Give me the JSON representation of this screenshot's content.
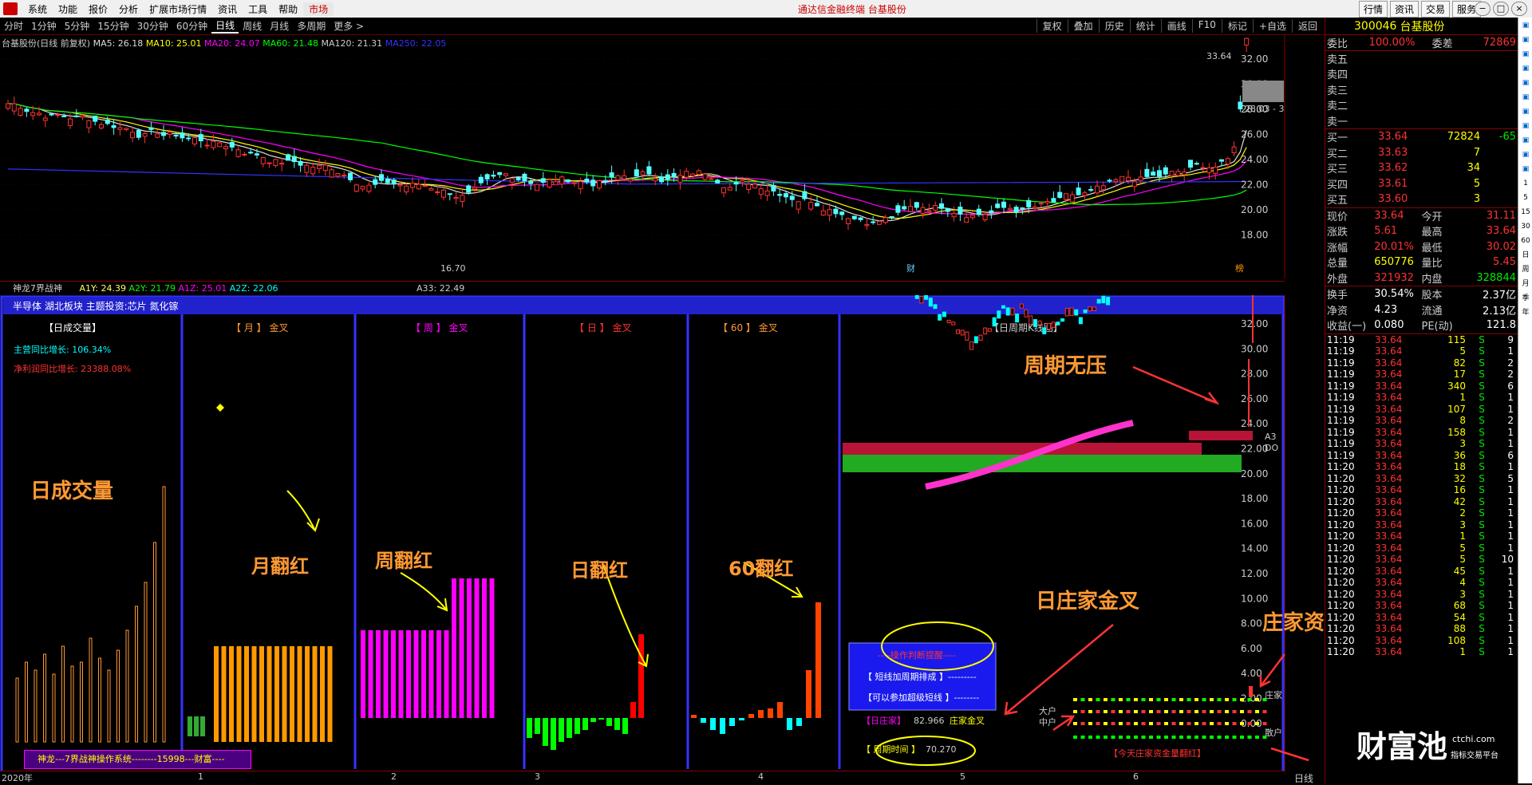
{
  "menu": [
    "系统",
    "功能",
    "报价",
    "分析",
    "扩展市场行情",
    "资讯",
    "工具",
    "帮助",
    "市场"
  ],
  "app_title": "通达信金融终端 台基股份",
  "top_buttons": [
    "行情",
    "资讯",
    "交易",
    "服务"
  ],
  "periods": [
    "分时",
    "1分钟",
    "5分钟",
    "15分钟",
    "30分钟",
    "60分钟",
    "日线",
    "周线",
    "月线",
    "多周期",
    "更多 >"
  ],
  "active_period": "日线",
  "toolbar": [
    "复权",
    "叠加",
    "历史",
    "统计",
    "画线",
    "F10",
    "标记",
    "+自选",
    "返回"
  ],
  "main_legend": {
    "name": "台基股份(日线 前复权)",
    "ma5": "MA5: 26.18",
    "ma10": "MA10: 25.01",
    "ma20": "MA20: 24.07",
    "ma60": "MA60: 21.48",
    "ma120": "MA120: 21.31",
    "ma250": "MA250: 22.05"
  },
  "main_axis": [
    "32.00",
    "30.00",
    "28.00",
    "26.00",
    "24.00",
    "22.00",
    "20.00",
    "18.00"
  ],
  "main_labels": {
    "high": "33.64",
    "low": "16.70",
    "box": "28.03 - 3",
    "cai": "财",
    "gift": "榜"
  },
  "sub_legend": {
    "name": "神龙7界战神",
    "a1y": "A1Y: 24.39",
    "a2y": "A2Y: 21.79",
    "a1z": "A1Z: 25.01",
    "a2z": "A2Z: 22.06",
    "a33": "A33: 22.49"
  },
  "info_bar": "半导体 湖北板块 主题投资:芯片 氮化镓",
  "panels": {
    "p1_title": "【日成交量】",
    "p1_l1": "主营同比增长: 106.34%",
    "p1_l2": "净利润同比增长: 23388.08%",
    "p2_title": "【 月 】  金叉",
    "p3_title": "【 周 】  金叉",
    "p4_title": "【 日 】  金叉",
    "p5_title": "【 60 】  金叉",
    "p6_title": "【日周期K线图】"
  },
  "sub_axis": [
    "32.00",
    "30.00",
    "28.00",
    "26.00",
    "24.00",
    "22.00",
    "20.00",
    "18.00",
    "16.00",
    "14.00",
    "12.00",
    "10.00",
    "8.00",
    "6.00",
    "4.00",
    "2.00",
    "0.00"
  ],
  "side_labels": {
    "a3": "A3",
    "do": "DO",
    "zhuang": "庄家",
    "sanhu": "散户",
    "dahu": "大户",
    "zhonghu": "中户"
  },
  "ops": {
    "title": "----操作判断提醒----",
    "l1": "【 短线加周期排成 】---------",
    "l2": "【可以参加超级短线 】--------",
    "zj": "【日庄家】",
    "zj_val": "82.966",
    "zj_tag": "庄家金叉",
    "time": "【 周期时间 】",
    "time_val": "70.270",
    "today": "【今天庄家资金量翻红】"
  },
  "annotations": {
    "a1": "日成交量",
    "a2": "月翻红",
    "a3": "周翻红",
    "a4": "日翻红",
    "a5": "60翻红",
    "a6": "周期无压",
    "a7": "日庄家金叉",
    "a8": "庄家资金能量翻红"
  },
  "footer_label": "神龙---7界战神操作系统--------15998---财富----",
  "x_axis": [
    "2020年",
    "1",
    "2",
    "3",
    "4",
    "5",
    "6"
  ],
  "x_axis_right": "日线",
  "quote": {
    "code": "300046",
    "name": "台基股份",
    "wb_label": "委比",
    "wb_val": "100.00%",
    "wc_label": "委差",
    "wc_val": "72869",
    "sells": [
      "卖五",
      "卖四",
      "卖三",
      "卖二",
      "卖一"
    ],
    "buys": [
      [
        "买一",
        "33.64",
        "72824",
        "-65"
      ],
      [
        "买二",
        "33.63",
        "7",
        ""
      ],
      [
        "买三",
        "33.62",
        "34",
        ""
      ],
      [
        "买四",
        "33.61",
        "5",
        ""
      ],
      [
        "买五",
        "33.60",
        "3",
        ""
      ]
    ],
    "stats": [
      [
        "现价",
        "33.64",
        "今开",
        "31.11"
      ],
      [
        "涨跌",
        "5.61",
        "最高",
        "33.64"
      ],
      [
        "涨幅",
        "20.01%",
        "最低",
        "30.02"
      ],
      [
        "总量",
        "650776",
        "量比",
        "5.45"
      ],
      [
        "外盘",
        "321932",
        "内盘",
        "328844"
      ]
    ],
    "stats2": [
      [
        "换手",
        "30.54%",
        "股本",
        "2.37亿"
      ],
      [
        "净资",
        "4.23",
        "流通",
        "2.13亿"
      ],
      [
        "收益(一)",
        "0.080",
        "PE(动)",
        "121.8"
      ]
    ]
  },
  "ticks": [
    [
      "11:19",
      "33.64",
      "115",
      "S",
      "9"
    ],
    [
      "11:19",
      "33.64",
      "5",
      "S",
      "1"
    ],
    [
      "11:19",
      "33.64",
      "82",
      "S",
      "2"
    ],
    [
      "11:19",
      "33.64",
      "17",
      "S",
      "2"
    ],
    [
      "11:19",
      "33.64",
      "340",
      "S",
      "6"
    ],
    [
      "11:19",
      "33.64",
      "1",
      "S",
      "1"
    ],
    [
      "11:19",
      "33.64",
      "107",
      "S",
      "1"
    ],
    [
      "11:19",
      "33.64",
      "8",
      "S",
      "2"
    ],
    [
      "11:19",
      "33.64",
      "158",
      "S",
      "1"
    ],
    [
      "11:19",
      "33.64",
      "3",
      "S",
      "1"
    ],
    [
      "11:19",
      "33.64",
      "36",
      "S",
      "6"
    ],
    [
      "11:20",
      "33.64",
      "18",
      "S",
      "1"
    ],
    [
      "11:20",
      "33.64",
      "32",
      "S",
      "5"
    ],
    [
      "11:20",
      "33.64",
      "16",
      "S",
      "1"
    ],
    [
      "11:20",
      "33.64",
      "42",
      "S",
      "1"
    ],
    [
      "11:20",
      "33.64",
      "2",
      "S",
      "1"
    ],
    [
      "11:20",
      "33.64",
      "3",
      "S",
      "1"
    ],
    [
      "11:20",
      "33.64",
      "1",
      "S",
      "1"
    ],
    [
      "11:20",
      "33.64",
      "5",
      "S",
      "1"
    ],
    [
      "11:20",
      "33.64",
      "5",
      "S",
      "10"
    ],
    [
      "11:20",
      "33.64",
      "45",
      "S",
      "1"
    ],
    [
      "11:20",
      "33.64",
      "4",
      "S",
      "1"
    ],
    [
      "11:20",
      "33.64",
      "3",
      "S",
      "1"
    ],
    [
      "11:20",
      "33.64",
      "68",
      "S",
      "1"
    ],
    [
      "11:20",
      "33.64",
      "54",
      "S",
      "1"
    ],
    [
      "11:20",
      "33.64",
      "88",
      "S",
      "1"
    ],
    [
      "11:20",
      "33.64",
      "108",
      "S",
      "1"
    ],
    [
      "11:20",
      "33.64",
      "1",
      "S",
      "1"
    ]
  ],
  "sidebar_icons": [
    "up-arrow-icon",
    "chart-icon",
    "k-icon",
    "bar-icon",
    "list-icon",
    "fund-icon",
    "news-icon",
    "f10-icon",
    "info-icon",
    "rsi-icon",
    "pen-icon"
  ],
  "sidebar_periods": [
    "1",
    "5",
    "15",
    "30",
    "60",
    "日",
    "周",
    "月",
    "季",
    "年"
  ],
  "watermark": "财富池",
  "watermark_small": "ctchi.com",
  "watermark_small2": "指标交易平台"
}
